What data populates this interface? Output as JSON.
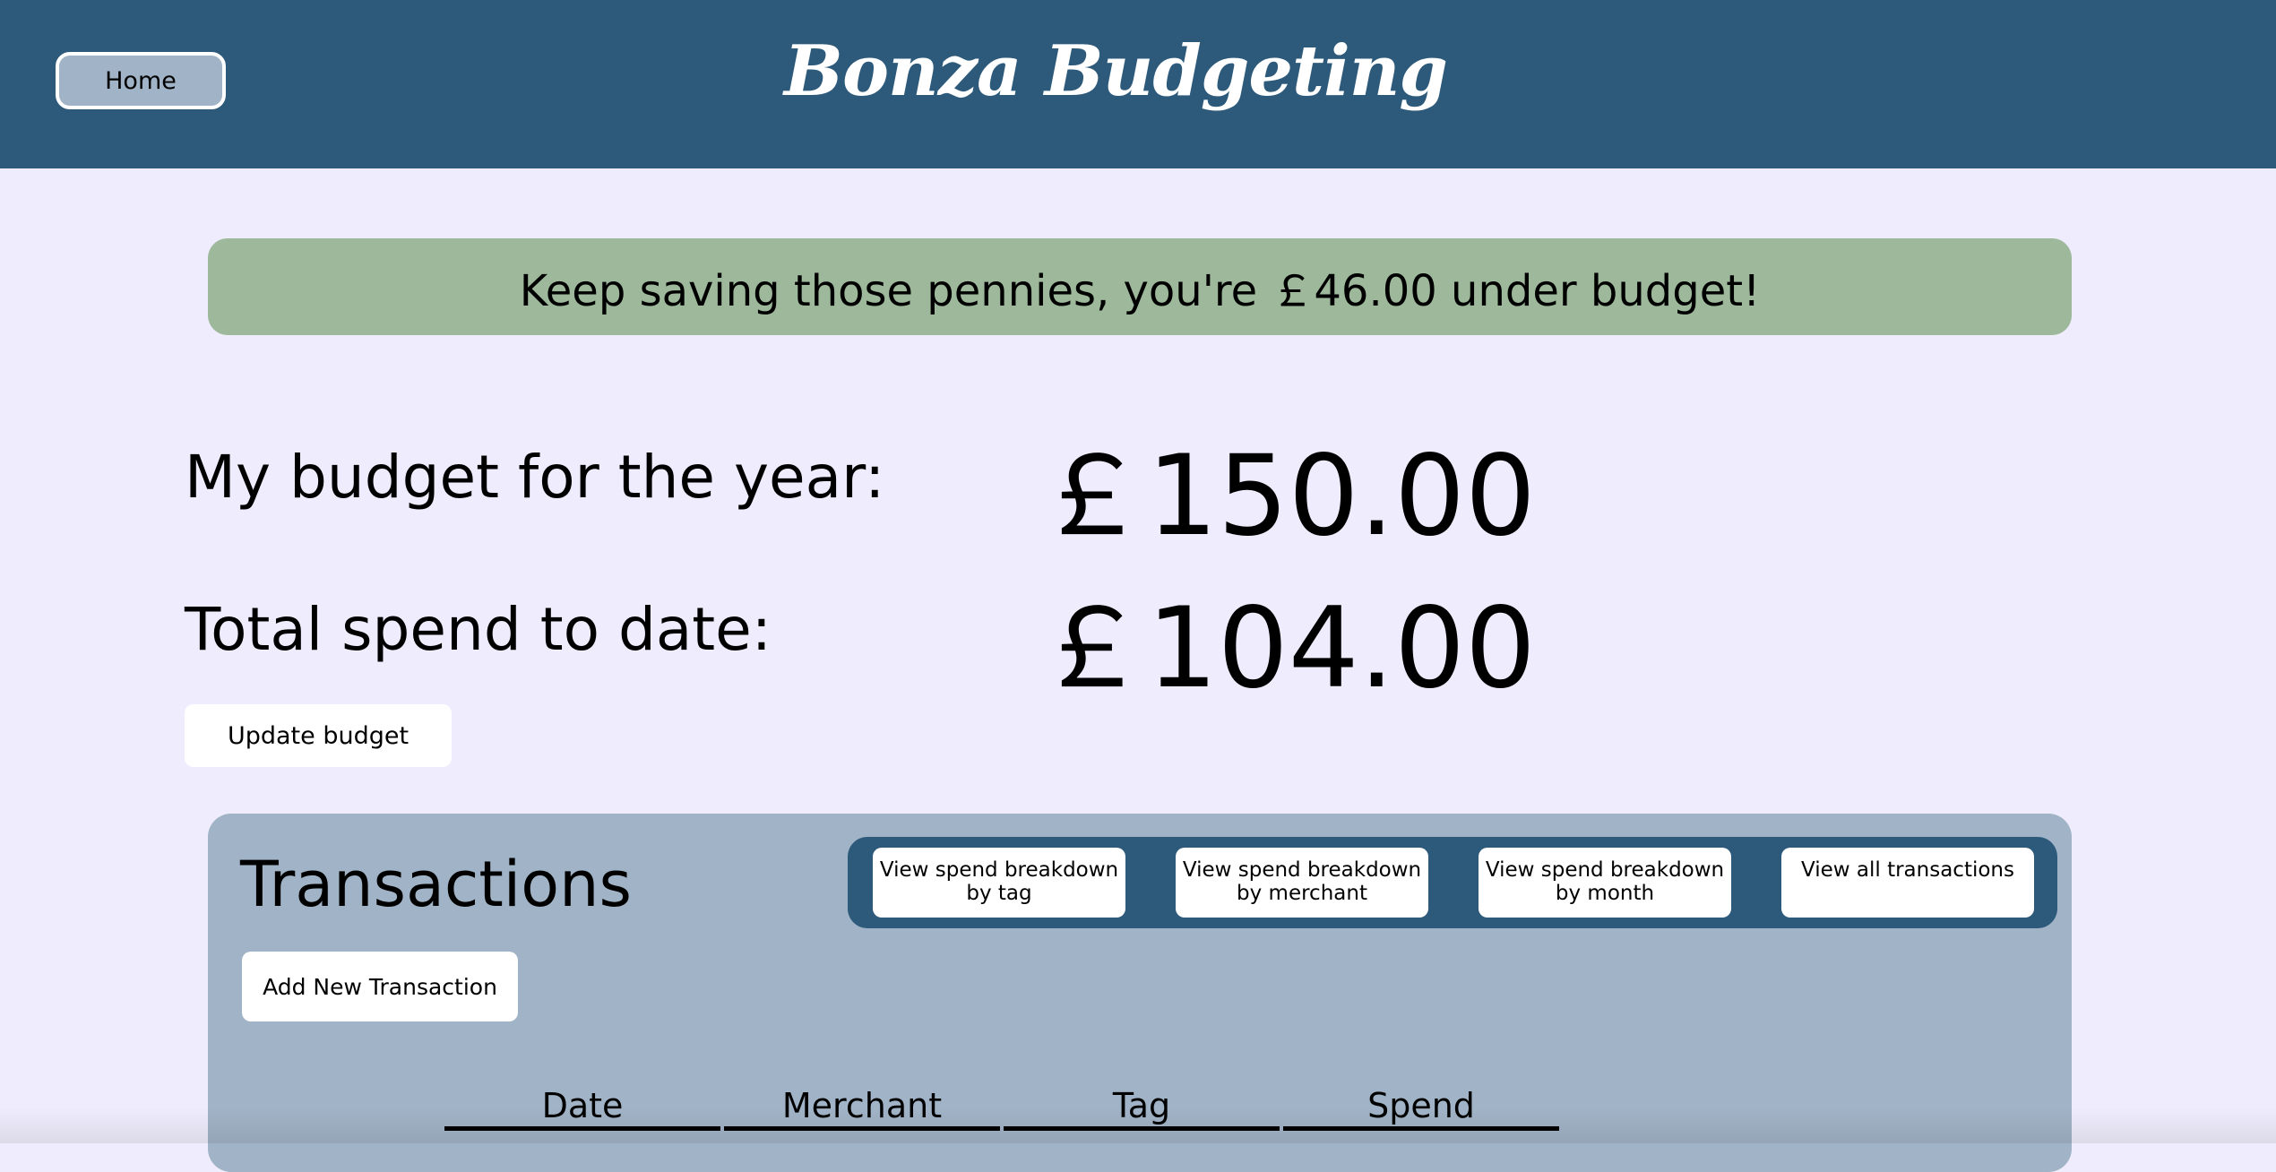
{
  "header": {
    "home_label": "Home",
    "app_title": "Bonza Budgeting"
  },
  "banner": {
    "message": "Keep saving those pennies, you're ￡46.00 under budget!"
  },
  "summary": {
    "budget_label": "My budget for the year:",
    "budget_value": "￡150.00",
    "spend_label": "Total spend to date:",
    "spend_value": "￡104.00",
    "update_label": "Update budget"
  },
  "transactions": {
    "title": "Transactions",
    "buttons": [
      {
        "line1": "View spend breakdown",
        "line2": "by tag"
      },
      {
        "line1": "View spend breakdown",
        "line2": "by merchant"
      },
      {
        "line1": "View spend breakdown",
        "line2": "by month"
      },
      {
        "line1": "View all transactions",
        "line2": ""
      }
    ],
    "add_label": "Add New Transaction",
    "columns": [
      "Date",
      "Merchant",
      "Tag",
      "Spend"
    ]
  },
  "colors": {
    "header_bg": "#2d5a7b",
    "page_bg": "#efedfd",
    "banner_bg": "#9db89a",
    "panel_bg": "#a1b3c6"
  }
}
